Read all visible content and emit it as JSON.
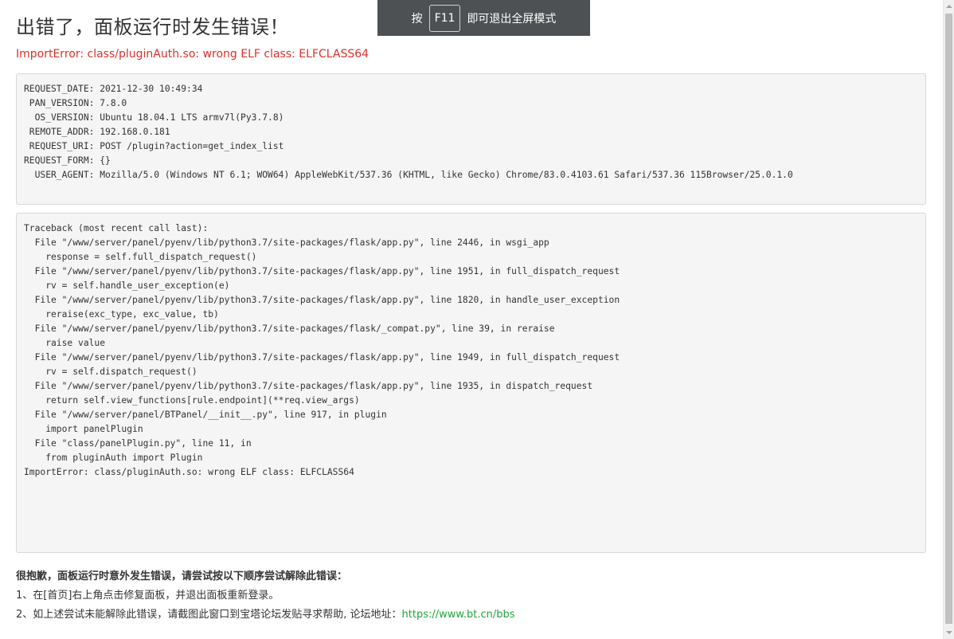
{
  "header": {
    "title": "出错了，面板运行时发生错误！",
    "error_message": "ImportError: class/pluginAuth.so: wrong ELF class: ELFCLASS64"
  },
  "request_info": "REQUEST_DATE: 2021-12-30 10:49:34\n PAN_VERSION: 7.8.0\n  OS_VERSION: Ubuntu 18.04.1 LTS armv7l(Py3.7.8)\n REMOTE_ADDR: 192.168.0.181\n REQUEST_URI: POST /plugin?action=get_index_list\nREQUEST_FORM: {}\n  USER_AGENT: Mozilla/5.0 (Windows NT 6.1; WOW64) AppleWebKit/537.36 (KHTML, like Gecko) Chrome/83.0.4103.61 Safari/537.36 115Browser/25.0.1.0",
  "traceback": "Traceback (most recent call last):\n  File \"/www/server/panel/pyenv/lib/python3.7/site-packages/flask/app.py\", line 2446, in wsgi_app\n    response = self.full_dispatch_request()\n  File \"/www/server/panel/pyenv/lib/python3.7/site-packages/flask/app.py\", line 1951, in full_dispatch_request\n    rv = self.handle_user_exception(e)\n  File \"/www/server/panel/pyenv/lib/python3.7/site-packages/flask/app.py\", line 1820, in handle_user_exception\n    reraise(exc_type, exc_value, tb)\n  File \"/www/server/panel/pyenv/lib/python3.7/site-packages/flask/_compat.py\", line 39, in reraise\n    raise value\n  File \"/www/server/panel/pyenv/lib/python3.7/site-packages/flask/app.py\", line 1949, in full_dispatch_request\n    rv = self.dispatch_request()\n  File \"/www/server/panel/pyenv/lib/python3.7/site-packages/flask/app.py\", line 1935, in dispatch_request\n    return self.view_functions[rule.endpoint](**req.view_args)\n  File \"/www/server/panel/BTPanel/__init__.py\", line 917, in plugin\n    import panelPlugin\n  File \"class/panelPlugin.py\", line 11, in\n    from pluginAuth import Plugin\nImportError: class/pluginAuth.so: wrong ELF class: ELFCLASS64",
  "help": {
    "title": "很抱歉，面板运行时意外发生错误，请尝试按以下顺序尝试解除此错误：",
    "step1": "1、在[首页]右上角点击修复面板，并退出面板重新登录。",
    "step2_text": "2、如上述尝试未能解除此错误，请截图此窗口到宝塔论坛发贴寻求帮助, 论坛地址：",
    "step2_link": "https://www.bt.cn/bbs"
  },
  "fullscreen_toast": {
    "prefix": "按",
    "key": "F11",
    "suffix": "即可退出全屏模式"
  },
  "colors": {
    "error_text": "#d9312b",
    "link": "#20a53a",
    "toast_bg": "#4e5153"
  }
}
